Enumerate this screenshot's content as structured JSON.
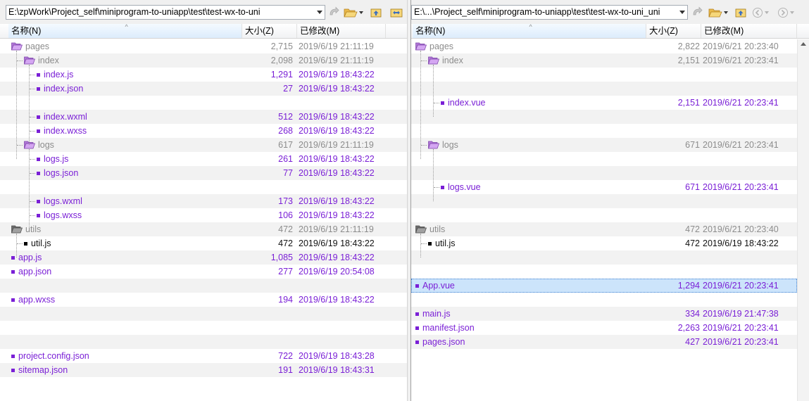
{
  "left": {
    "path": "E:\\zpWork\\Project_self\\miniprogram-to-uniapp\\test\\test-wx-to-uni",
    "columns": {
      "name": "名称(N)",
      "size": "大小(Z)",
      "modified": "已修改(M)"
    },
    "rows": [
      {
        "name": "pages",
        "size": "2,715",
        "date": "2019/6/19 21:11:19",
        "kind": "folder",
        "depth": 0,
        "color": "gray"
      },
      {
        "name": "index",
        "size": "2,098",
        "date": "2019/6/19 21:11:19",
        "kind": "folder",
        "depth": 1,
        "color": "gray"
      },
      {
        "name": "index.js",
        "size": "1,291",
        "date": "2019/6/19 18:43:22",
        "kind": "file",
        "depth": 2,
        "color": "purple"
      },
      {
        "name": "index.json",
        "size": "27",
        "date": "2019/6/19 18:43:22",
        "kind": "file",
        "depth": 2,
        "color": "purple"
      },
      {
        "name": "",
        "size": "",
        "date": "",
        "kind": "blank",
        "depth": 2,
        "color": ""
      },
      {
        "name": "index.wxml",
        "size": "512",
        "date": "2019/6/19 18:43:22",
        "kind": "file",
        "depth": 2,
        "color": "purple"
      },
      {
        "name": "index.wxss",
        "size": "268",
        "date": "2019/6/19 18:43:22",
        "kind": "file",
        "depth": 2,
        "color": "purple"
      },
      {
        "name": "logs",
        "size": "617",
        "date": "2019/6/19 21:11:19",
        "kind": "folder",
        "depth": 1,
        "color": "gray"
      },
      {
        "name": "logs.js",
        "size": "261",
        "date": "2019/6/19 18:43:22",
        "kind": "file",
        "depth": 2,
        "color": "purple"
      },
      {
        "name": "logs.json",
        "size": "77",
        "date": "2019/6/19 18:43:22",
        "kind": "file",
        "depth": 2,
        "color": "purple"
      },
      {
        "name": "",
        "size": "",
        "date": "",
        "kind": "blank",
        "depth": 2,
        "color": ""
      },
      {
        "name": "logs.wxml",
        "size": "173",
        "date": "2019/6/19 18:43:22",
        "kind": "file",
        "depth": 2,
        "color": "purple"
      },
      {
        "name": "logs.wxss",
        "size": "106",
        "date": "2019/6/19 18:43:22",
        "kind": "file",
        "depth": 2,
        "color": "purple"
      },
      {
        "name": "utils",
        "size": "472",
        "date": "2019/6/19 21:11:19",
        "kind": "folder-dark",
        "depth": 0,
        "color": "gray"
      },
      {
        "name": "util.js",
        "size": "472",
        "date": "2019/6/19 18:43:22",
        "kind": "file",
        "depth": 1,
        "color": "black"
      },
      {
        "name": "app.js",
        "size": "1,085",
        "date": "2019/6/19 18:43:22",
        "kind": "file",
        "depth": 0,
        "color": "purple"
      },
      {
        "name": "app.json",
        "size": "277",
        "date": "2019/6/19 20:54:08",
        "kind": "file",
        "depth": 0,
        "color": "purple"
      },
      {
        "name": "",
        "size": "",
        "date": "",
        "kind": "blank",
        "depth": 0,
        "color": ""
      },
      {
        "name": "app.wxss",
        "size": "194",
        "date": "2019/6/19 18:43:22",
        "kind": "file",
        "depth": 0,
        "color": "purple"
      },
      {
        "name": "",
        "size": "",
        "date": "",
        "kind": "blank",
        "depth": 0,
        "color": ""
      },
      {
        "name": "",
        "size": "",
        "date": "",
        "kind": "blank",
        "depth": 0,
        "color": ""
      },
      {
        "name": "",
        "size": "",
        "date": "",
        "kind": "blank",
        "depth": 0,
        "color": ""
      },
      {
        "name": "project.config.json",
        "size": "722",
        "date": "2019/6/19 18:43:28",
        "kind": "file",
        "depth": 0,
        "color": "purple"
      },
      {
        "name": "sitemap.json",
        "size": "191",
        "date": "2019/6/19 18:43:31",
        "kind": "file",
        "depth": 0,
        "color": "purple"
      }
    ]
  },
  "right": {
    "path": "E:\\...\\Project_self\\miniprogram-to-uniapp\\test\\test-wx-to-uni_uni",
    "columns": {
      "name": "名称(N)",
      "size": "大小(Z)",
      "modified": "已修改(M)"
    },
    "rows": [
      {
        "name": "pages",
        "size": "2,822",
        "date": "2019/6/21 20:23:40",
        "kind": "folder",
        "depth": 0,
        "color": "gray"
      },
      {
        "name": "index",
        "size": "2,151",
        "date": "2019/6/21 20:23:41",
        "kind": "folder",
        "depth": 1,
        "color": "gray"
      },
      {
        "name": "",
        "size": "",
        "date": "",
        "kind": "blank",
        "depth": 2,
        "color": ""
      },
      {
        "name": "",
        "size": "",
        "date": "",
        "kind": "blank",
        "depth": 2,
        "color": ""
      },
      {
        "name": "index.vue",
        "size": "2,151",
        "date": "2019/6/21 20:23:41",
        "kind": "file",
        "depth": 2,
        "color": "purple"
      },
      {
        "name": "",
        "size": "",
        "date": "",
        "kind": "blank",
        "depth": 1,
        "color": ""
      },
      {
        "name": "",
        "size": "",
        "date": "",
        "kind": "blank",
        "depth": 1,
        "color": ""
      },
      {
        "name": "logs",
        "size": "671",
        "date": "2019/6/21 20:23:41",
        "kind": "folder",
        "depth": 1,
        "color": "gray"
      },
      {
        "name": "",
        "size": "",
        "date": "",
        "kind": "blank",
        "depth": 2,
        "color": ""
      },
      {
        "name": "",
        "size": "",
        "date": "",
        "kind": "blank",
        "depth": 2,
        "color": ""
      },
      {
        "name": "logs.vue",
        "size": "671",
        "date": "2019/6/21 20:23:41",
        "kind": "file",
        "depth": 2,
        "color": "purple"
      },
      {
        "name": "",
        "size": "",
        "date": "",
        "kind": "blank",
        "depth": 0,
        "color": ""
      },
      {
        "name": "",
        "size": "",
        "date": "",
        "kind": "blank",
        "depth": 0,
        "color": ""
      },
      {
        "name": "utils",
        "size": "472",
        "date": "2019/6/21 20:23:40",
        "kind": "folder-dark",
        "depth": 0,
        "color": "gray"
      },
      {
        "name": "util.js",
        "size": "472",
        "date": "2019/6/19 18:43:22",
        "kind": "file",
        "depth": 1,
        "color": "black"
      },
      {
        "name": "",
        "size": "",
        "date": "",
        "kind": "blank",
        "depth": 0,
        "color": ""
      },
      {
        "name": "",
        "size": "",
        "date": "",
        "kind": "blank",
        "depth": 0,
        "color": ""
      },
      {
        "name": "App.vue",
        "size": "1,294",
        "date": "2019/6/21 20:23:41",
        "kind": "file",
        "depth": 0,
        "color": "purple",
        "selected": true
      },
      {
        "name": "",
        "size": "",
        "date": "",
        "kind": "blank",
        "depth": 0,
        "color": ""
      },
      {
        "name": "main.js",
        "size": "334",
        "date": "2019/6/19 21:47:38",
        "kind": "file",
        "depth": 0,
        "color": "purple"
      },
      {
        "name": "manifest.json",
        "size": "2,263",
        "date": "2019/6/21 20:23:41",
        "kind": "file",
        "depth": 0,
        "color": "purple"
      },
      {
        "name": "pages.json",
        "size": "427",
        "date": "2019/6/21 20:23:41",
        "kind": "file",
        "depth": 0,
        "color": "purple"
      }
    ]
  },
  "colors": {
    "diff_purple": "#7a1fd6",
    "same_gray": "#8c8c8c",
    "selection": "#cce4fb",
    "alt_row": "#f2f2f2"
  },
  "icons": [
    "swap-icon",
    "folder-open-icon",
    "up-folder-icon",
    "sync-icon",
    "back-icon",
    "forward-icon"
  ]
}
